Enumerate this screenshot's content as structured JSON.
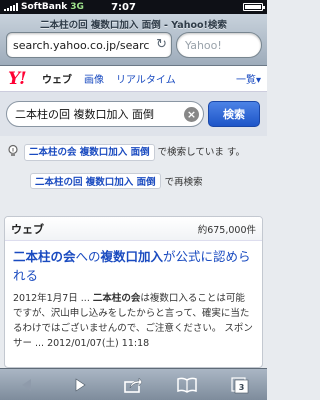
{
  "status_bar": {
    "carrier": "SoftBank",
    "network": "3G",
    "time": "7:07"
  },
  "browser": {
    "page_title": "二本柱の回 複数口加入 面倒 - Yahoo!検索",
    "url": "search.yahoo.co.jp/searc",
    "search_placeholder": "Yahoo!"
  },
  "yahoo_nav": {
    "logo": "Y!",
    "tabs": [
      "ウェブ",
      "画像",
      "リアルタイム"
    ],
    "more_label": "一覧▾"
  },
  "search": {
    "query": "二本柱の回 複数口加入 面倒",
    "clear_icon": "clear-icon",
    "button_label": "検索"
  },
  "suggestion": {
    "corrected_query": "二本柱の会 複数口加入 面倒",
    "corrected_suffix": "で検索していま す。",
    "original_query": "二本柱の回 複数口加入 面倒",
    "original_suffix": "で再検索"
  },
  "results": {
    "header": "ウェブ",
    "count": "約675,000件",
    "items": [
      {
        "title_p1": "二本柱の会",
        "title_p2": "への",
        "title_p3": "複数口加入",
        "title_p4": "が公式に認められる",
        "snippet_date": "2012年1月7日 ...",
        "snippet_bold": "二本柱の会",
        "snippet_text": "は複数口入ることは可能ですが、沢山申し込みをしたからと言って、確実に当たるわけではございませんので、ご注意ください。 スポンサー ... 2012/01/07(土) 11:18"
      }
    ]
  },
  "toolbar": {
    "pages_count": "3"
  },
  "colors": {
    "link": "#1a4bc0",
    "yahoo_red": "#ff0033",
    "search_button": "#1e55c8"
  }
}
